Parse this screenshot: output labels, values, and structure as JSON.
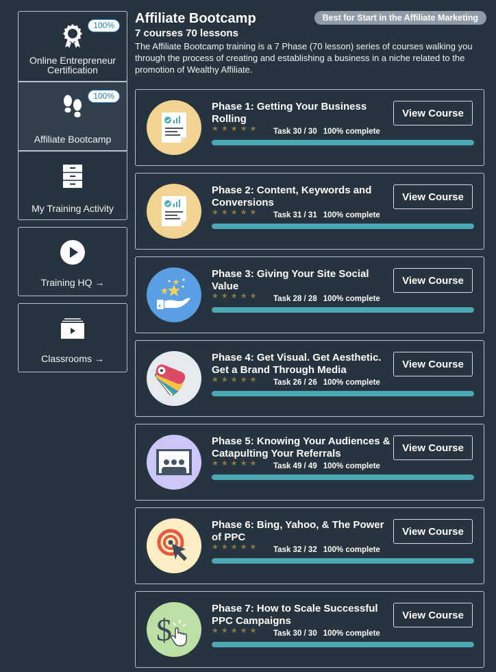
{
  "sidebar": {
    "group": [
      {
        "label": "Online Entrepreneur Certification",
        "badge": "100%",
        "icon": "award-rosette-icon",
        "active": false
      },
      {
        "label": "Affiliate Bootcamp",
        "badge": "100%",
        "icon": "footprints-icon",
        "active": true
      },
      {
        "label": "My Training Activity",
        "icon": "file-cabinet-icon",
        "active": false
      }
    ],
    "links": [
      {
        "label": "Training HQ →",
        "icon": "play-circle-icon"
      },
      {
        "label": "Classrooms →",
        "icon": "video-stack-icon"
      }
    ]
  },
  "header": {
    "title": "Affiliate Bootcamp",
    "subtitle": "7 courses 70 lessons",
    "description": "The Affiliate Bootcamp training is a 7 Phase (70 lesson) series of courses walking you through the process of creating and establishing a business in a niche related to the promotion of Wealthy Affiliate.",
    "tag": "Best for Start in the Affiliate Marketing"
  },
  "colors": {
    "background": "#263440",
    "progress": "#4ca8b4",
    "stars": "#8a7a44",
    "badge_text": "#2b7bbf"
  },
  "courses": [
    {
      "title": "Phase 1: Getting Your Business Rolling",
      "rating": 5,
      "task": "Task 30 / 30",
      "complete": "100% complete",
      "progress": 100,
      "button": "View Course",
      "icon": "report-document-icon",
      "icon_bg": "#f2d392"
    },
    {
      "title": "Phase 2: Content, Keywords and Conversions",
      "rating": 5,
      "task": "Task 31 / 31",
      "complete": "100% complete",
      "progress": 100,
      "button": "View Course",
      "icon": "report-document-icon",
      "icon_bg": "#f2d392"
    },
    {
      "title": "Phase 3: Giving Your Site Social Value",
      "rating": 5,
      "task": "Task 28 / 28",
      "complete": "100% complete",
      "progress": 100,
      "button": "View Course",
      "icon": "hand-stars-icon",
      "icon_bg": "#5a9fe3"
    },
    {
      "title": "Phase 4: Get Visual.  Get Aesthetic. Get a Brand Through Media",
      "rating": 5,
      "task": "Task 26 / 26",
      "complete": "100% complete",
      "progress": 100,
      "button": "View Course",
      "icon": "color-swatch-icon",
      "icon_bg": "#e6eaee"
    },
    {
      "title": "Phase 5: Knowing Your Audiences & Catapulting Your Referrals",
      "rating": 5,
      "task": "Task 49 / 49",
      "complete": "100% complete",
      "progress": 100,
      "button": "View Course",
      "icon": "audience-presentation-icon",
      "icon_bg": "#cbc6f7"
    },
    {
      "title": "Phase 6: Bing, Yahoo, & The Power of PPC",
      "rating": 5,
      "task": "Task 32 / 32",
      "complete": "100% complete",
      "progress": 100,
      "button": "View Course",
      "icon": "target-click-icon",
      "icon_bg": "#fdedc3"
    },
    {
      "title": "Phase 7: How to Scale Successful PPC Campaigns",
      "rating": 5,
      "task": "Task 30 / 30",
      "complete": "100% complete",
      "progress": 100,
      "button": "View Course",
      "icon": "dollar-click-icon",
      "icon_bg": "#bcdfa4"
    }
  ]
}
